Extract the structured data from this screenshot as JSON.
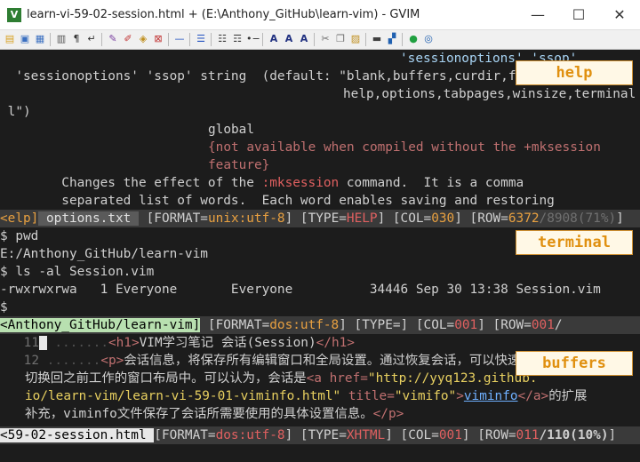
{
  "window": {
    "title": "learn-vi-59-02-session.html + (E:\\Anthony_GitHub\\learn-vim) - GVIM",
    "app_icon": "V",
    "controls": {
      "minimize": "—",
      "maximize": "☐",
      "close": "✕"
    }
  },
  "toolbar_icons": [
    "open-icon",
    "save-icon",
    "save-all-icon",
    "print-icon",
    "undo-icon",
    "redo-icon",
    "cut-icon",
    "copy-icon",
    "paste-icon",
    "find-icon",
    "find-next-icon",
    "find-prev-icon",
    "load-session-icon",
    "save-session-icon",
    "run-script-icon",
    "make-icon",
    "run-ctags-icon",
    "tag-jump-icon",
    "help-icon",
    "find-help-icon"
  ],
  "help": {
    "lines": [
      [
        "",
        "",
        "",
        "'sessionoptions' 'ssop'"
      ],
      [
        "  'sessionoptions' 'ssop' string  (default: \"blank,buffers,curdir,folds,",
        "",
        "",
        ""
      ],
      [
        "",
        "help,options,tabpages,winsize,terminal",
        "",
        ""
      ],
      [
        " l\")",
        "",
        "",
        ""
      ],
      [
        "",
        "global",
        "",
        ""
      ],
      [
        "",
        "{not available when compiled without the +mksession",
        "",
        ""
      ],
      [
        "",
        "feature}",
        "",
        ""
      ],
      [
        "        Changes the effect of the ",
        ":mksession",
        " command.  It is a comma",
        ""
      ],
      [
        "        separated list of words.  Each word enables saving and restoring",
        "",
        "",
        ""
      ]
    ],
    "statusline": {
      "prefix": "<elp]",
      "file": " options.txt ",
      "format_label": " [FORMAT=",
      "format_value": "unix:utf-8",
      "type_label": "] [TYPE=",
      "type_value": "HELP",
      "col_label": "] [COL=",
      "col_value": "030",
      "row_label": "] [ROW=",
      "row_value": "6372",
      "row_total": "/8908(71%)",
      "end": "]"
    },
    "badge": "help"
  },
  "terminal": {
    "lines": [
      "$ pwd",
      "E:/Anthony_GitHub/learn-vim",
      "$ ls -al Session.vim",
      "-rwxrwxrwa   1 Everyone       Everyone          34446 Sep 30 13:38 Session.vim",
      "$"
    ],
    "statusline": {
      "path": "<Anthony_GitHub/learn-vim]",
      "format_label": " [FORMAT=",
      "format_value": "dos:utf-8",
      "type_label": "] [TYPE=",
      "type_value": "",
      "col_label": "] [COL=",
      "col_value": "001",
      "row_label": "] [ROW=",
      "row_value": "001",
      "row_total": "/"
    },
    "badge": "terminal"
  },
  "buffer": {
    "line11": {
      "num": "11",
      "dots": " .......",
      "tag_open": "<h1>",
      "text": "VIM学习笔记 会话(Session)",
      "tag_close": "</h1>"
    },
    "line12": {
      "num": "12",
      "dots": " .......",
      "tag_open": "<p>",
      "text": "会话信息，将保存所有编辑窗口和全局设置。通过恢复会话，可以快速"
    },
    "wrap1": {
      "text": "切换回之前工作的窗口布局中。可以认为，会话是",
      "a_open": "<a href=",
      "href": "\"http://yyq123.github.",
      "text2": ""
    },
    "wrap2": {
      "href": "io/learn-vim/learn-vi-59-01-viminfo.html\"",
      "attr": " title=",
      "title": "\"vimifo\"",
      "gt": ">",
      "link": "viminfo",
      "a_close": "</a>",
      "after": "的扩展"
    },
    "wrap3": {
      "text": "补充，viminfo文件保存了会话所需要使用的具体设置信息。",
      "p_close": "</p>"
    },
    "statusline": {
      "file": "<59-02-session.html ",
      "format_label": "[FORMAT=",
      "format_value": "dos:utf-8",
      "type_label": "] [TYPE=",
      "type_value": "XHTML",
      "col_label": "] [COL=",
      "col_value": "001",
      "row_label": "] [ROW=",
      "row_value": "011",
      "row_total": "/110(10%)",
      "end": "]"
    },
    "badge": "buffers"
  }
}
